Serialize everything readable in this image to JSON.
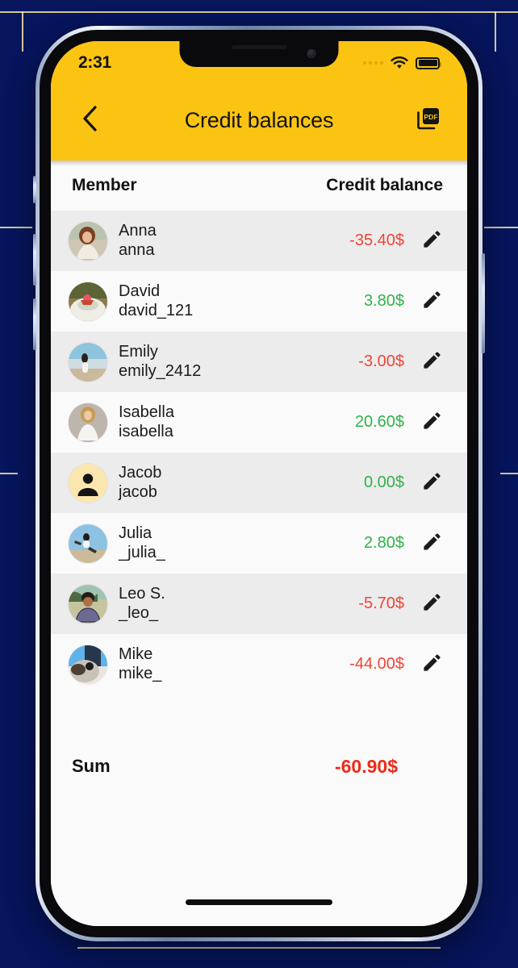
{
  "theme": {
    "accent": "#FCC412",
    "backdrop": "#06155c",
    "positive": "#2FB34A",
    "negative": "#F04438",
    "sum_color": "#EE2B18",
    "row_alt": "#ECECEC",
    "row_base": "#FAFAFA"
  },
  "status_bar": {
    "time": "2:31",
    "signal_icon": "signal-dots-icon",
    "wifi_icon": "wifi-icon",
    "battery_icon": "battery-full-icon"
  },
  "app_bar": {
    "back_icon": "chevron-left-icon",
    "title": "Credit balances",
    "pdf_icon": "pdf-export-icon"
  },
  "table": {
    "headers": {
      "member": "Member",
      "balance": "Credit balance"
    },
    "edit_icon": "pencil-icon",
    "rows": [
      {
        "name": "Anna",
        "handle": "anna",
        "amount": "-35.40$",
        "sign": "neg",
        "avatar": "photo-anna",
        "avatar_type": "photo"
      },
      {
        "name": "David",
        "handle": "david_121",
        "amount": "3.80$",
        "sign": "pos",
        "avatar": "photo-david",
        "avatar_type": "photo"
      },
      {
        "name": "Emily",
        "handle": "emily_2412",
        "amount": "-3.00$",
        "sign": "neg",
        "avatar": "photo-emily",
        "avatar_type": "photo"
      },
      {
        "name": "Isabella",
        "handle": "isabella",
        "amount": "20.60$",
        "sign": "pos",
        "avatar": "photo-isabella",
        "avatar_type": "photo"
      },
      {
        "name": "Jacob",
        "handle": "jacob",
        "amount": "0.00$",
        "sign": "pos",
        "avatar": "person-placeholder-icon",
        "avatar_type": "placeholder"
      },
      {
        "name": "Julia",
        "handle": "_julia_",
        "amount": "2.80$",
        "sign": "pos",
        "avatar": "photo-julia",
        "avatar_type": "photo"
      },
      {
        "name": "Leo S.",
        "handle": "_leo_",
        "amount": "-5.70$",
        "sign": "neg",
        "avatar": "photo-leo",
        "avatar_type": "photo"
      },
      {
        "name": "Mike",
        "handle": "mike_",
        "amount": "-44.00$",
        "sign": "neg",
        "avatar": "photo-mike",
        "avatar_type": "photo"
      }
    ],
    "summary": {
      "label": "Sum",
      "value": "-60.90$"
    }
  }
}
